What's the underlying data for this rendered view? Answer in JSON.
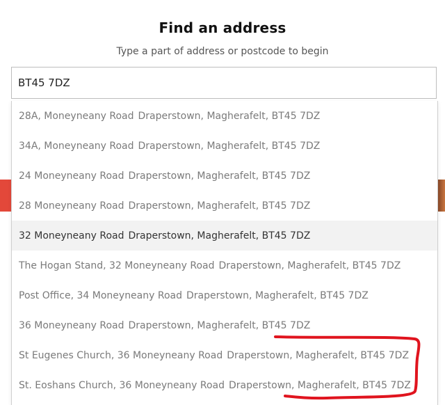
{
  "header": {
    "title": "Find an address",
    "subtitle": "Type a part of address or postcode to begin"
  },
  "search": {
    "value": "BT45 7DZ"
  },
  "results": [
    {
      "street": "28A, Moneyneany Road",
      "locality": "Draperstown, Magherafelt, BT45 7DZ",
      "highlighted": false
    },
    {
      "street": "34A, Moneyneany Road",
      "locality": "Draperstown, Magherafelt, BT45 7DZ",
      "highlighted": false
    },
    {
      "street": "24 Moneyneany Road",
      "locality": "Draperstown, Magherafelt, BT45 7DZ",
      "highlighted": false
    },
    {
      "street": "28 Moneyneany Road",
      "locality": "Draperstown, Magherafelt, BT45 7DZ",
      "highlighted": false
    },
    {
      "street": "32 Moneyneany Road",
      "locality": "Draperstown, Magherafelt, BT45 7DZ",
      "highlighted": true
    },
    {
      "street": "The Hogan Stand, 32 Moneyneany Road",
      "locality": "Draperstown, Magherafelt, BT45 7DZ",
      "highlighted": false
    },
    {
      "street": "Post Office, 34 Moneyneany Road",
      "locality": "Draperstown, Magherafelt, BT45 7DZ",
      "highlighted": false
    },
    {
      "street": "36 Moneyneany Road",
      "locality": "Draperstown, Magherafelt, BT45 7DZ",
      "highlighted": false
    },
    {
      "street": "St Eugenes Church, 36 Moneyneany Road",
      "locality": "Draperstown, Magherafelt, BT45 7DZ",
      "highlighted": false
    },
    {
      "street": "St. Eoshans Church, 36 Moneyneany Road",
      "locality": "Draperstown, Magherafelt, BT45 7DZ",
      "highlighted": false
    }
  ],
  "colors": {
    "annotation": "#e0141e",
    "highlight_row": "#f2f2f2",
    "result_text": "#7a7a7a"
  }
}
